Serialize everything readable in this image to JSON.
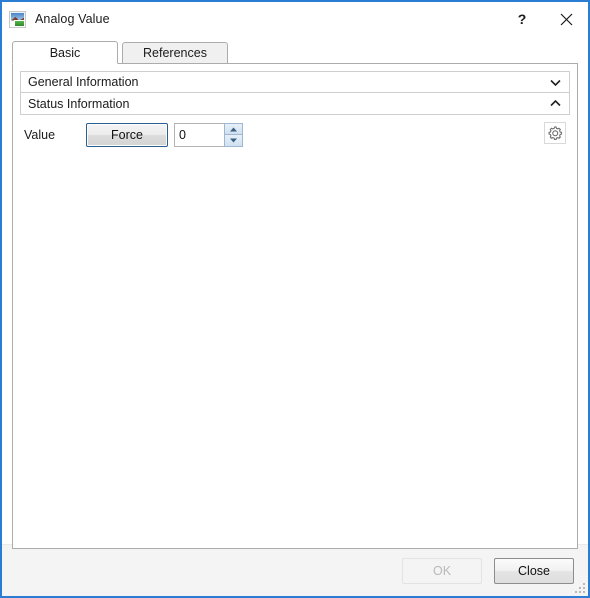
{
  "window": {
    "title": "Analog Value",
    "icon": "analog-value-app-icon",
    "border_color": "#2b7cd3",
    "controls": {
      "help_label": "?",
      "help_icon": "question-mark-icon",
      "close_icon": "close-x-icon"
    }
  },
  "tabs": [
    {
      "label": "Basic",
      "active": true
    },
    {
      "label": "References",
      "active": false
    }
  ],
  "sections": [
    {
      "title": "General Information",
      "expanded": false,
      "chevron_icon": "chevron-down-icon"
    },
    {
      "title": "Status Information",
      "expanded": true,
      "chevron_icon": "chevron-up-icon"
    }
  ],
  "status_information": {
    "value_row": {
      "label": "Value",
      "force_button_label": "Force",
      "input_value": "0",
      "input_placeholder": "",
      "spinner_up_icon": "spinner-up-arrow-icon",
      "spinner_down_icon": "spinner-down-arrow-icon",
      "settings_icon": "gear-icon"
    }
  },
  "footer": {
    "ok_label": "OK",
    "ok_enabled": false,
    "close_label": "Close",
    "close_enabled": true,
    "resize_grip_icon": "resize-grip-icon"
  }
}
